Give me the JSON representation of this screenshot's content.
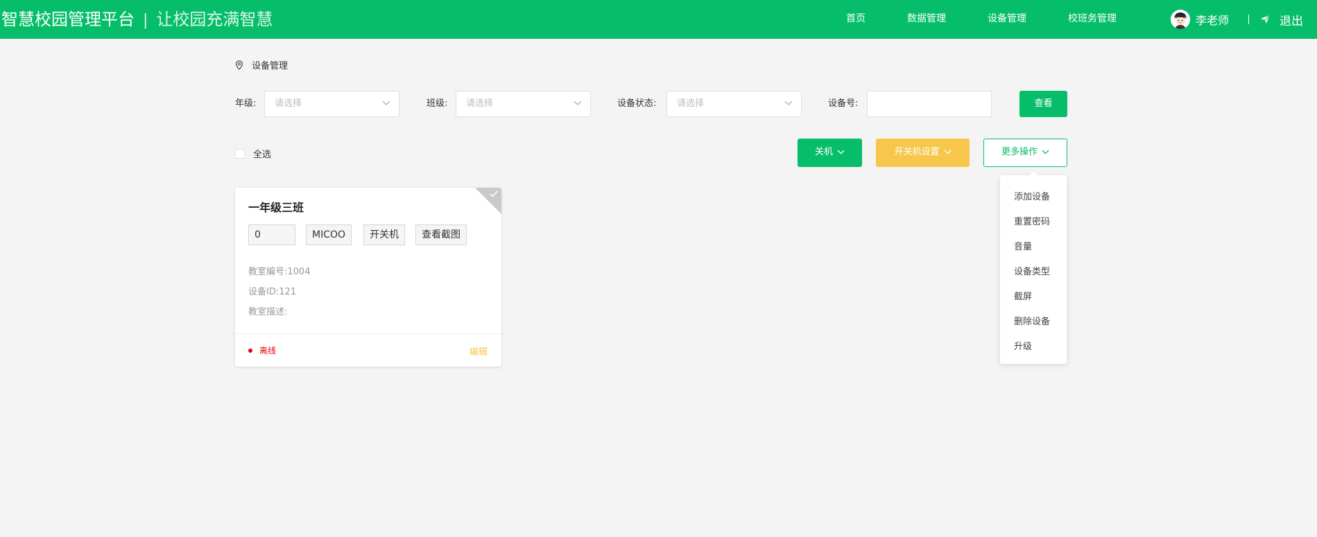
{
  "header": {
    "title": "智慧校园管理平台",
    "separator": "|",
    "slogan": "让校园充满智慧",
    "nav": [
      {
        "label": "首页"
      },
      {
        "label": "数据管理"
      },
      {
        "label": "设备管理"
      },
      {
        "label": "校班务管理"
      }
    ],
    "user_name": "李老师",
    "logout_label": "退出",
    "colors": {
      "primary": "#06be6a"
    }
  },
  "breadcrumb": {
    "icon": "location-pin-icon",
    "label": "设备管理"
  },
  "filters": {
    "grade": {
      "label": "年级:",
      "placeholder": "请选择"
    },
    "class": {
      "label": "班级:",
      "placeholder": "请选择"
    },
    "status": {
      "label": "设备状态:",
      "placeholder": "请选择"
    },
    "device_no": {
      "label": "设备号:",
      "value": ""
    },
    "search_label": "查看"
  },
  "toolbar": {
    "select_all_label": "全选",
    "shutdown_label": "关机",
    "power_settings_label": "开关机设置",
    "more_actions_label": "更多操作",
    "colors": {
      "green": "#06be6a",
      "yellow": "#f7c74c"
    }
  },
  "card": {
    "title": "一年级三班",
    "tags": [
      "0",
      "MICOO",
      "开关机",
      "查看截图"
    ],
    "classroom_no_label": "教室编号:",
    "classroom_no": "1004",
    "device_id_label": "设备ID:",
    "device_id": "121",
    "description_label": "教室描述:",
    "description": "",
    "status": "离线",
    "status_color": "#e60012",
    "edit_label": "编辑"
  },
  "more_menu": {
    "items": [
      {
        "label": "添加设备"
      },
      {
        "label": "重置密码"
      },
      {
        "label": "音量"
      },
      {
        "label": "设备类型"
      },
      {
        "label": "截屏"
      },
      {
        "label": "删除设备"
      },
      {
        "label": "升级"
      }
    ]
  }
}
